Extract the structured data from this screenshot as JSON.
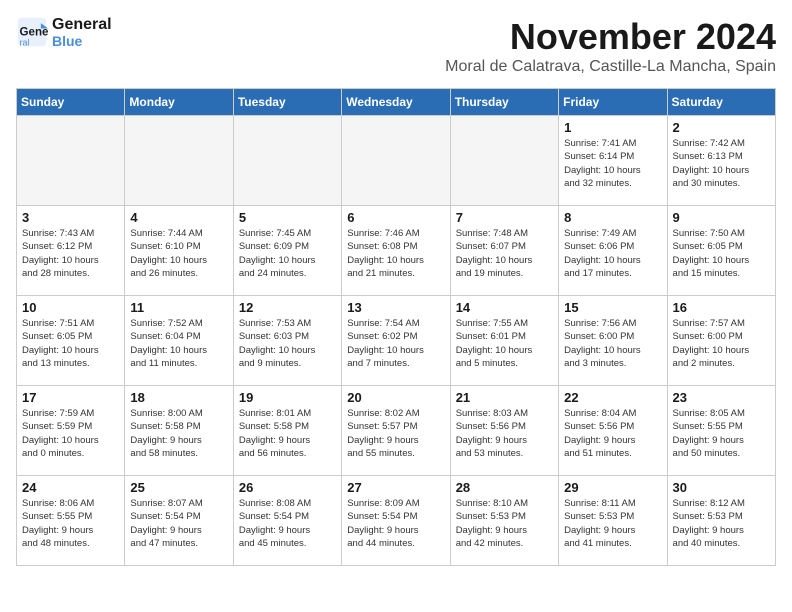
{
  "logo": {
    "line1": "General",
    "line2": "Blue"
  },
  "title": "November 2024",
  "subtitle": "Moral de Calatrava, Castille-La Mancha, Spain",
  "weekdays": [
    "Sunday",
    "Monday",
    "Tuesday",
    "Wednesday",
    "Thursday",
    "Friday",
    "Saturday"
  ],
  "weeks": [
    [
      {
        "day": "",
        "info": ""
      },
      {
        "day": "",
        "info": ""
      },
      {
        "day": "",
        "info": ""
      },
      {
        "day": "",
        "info": ""
      },
      {
        "day": "",
        "info": ""
      },
      {
        "day": "1",
        "info": "Sunrise: 7:41 AM\nSunset: 6:14 PM\nDaylight: 10 hours\nand 32 minutes."
      },
      {
        "day": "2",
        "info": "Sunrise: 7:42 AM\nSunset: 6:13 PM\nDaylight: 10 hours\nand 30 minutes."
      }
    ],
    [
      {
        "day": "3",
        "info": "Sunrise: 7:43 AM\nSunset: 6:12 PM\nDaylight: 10 hours\nand 28 minutes."
      },
      {
        "day": "4",
        "info": "Sunrise: 7:44 AM\nSunset: 6:10 PM\nDaylight: 10 hours\nand 26 minutes."
      },
      {
        "day": "5",
        "info": "Sunrise: 7:45 AM\nSunset: 6:09 PM\nDaylight: 10 hours\nand 24 minutes."
      },
      {
        "day": "6",
        "info": "Sunrise: 7:46 AM\nSunset: 6:08 PM\nDaylight: 10 hours\nand 21 minutes."
      },
      {
        "day": "7",
        "info": "Sunrise: 7:48 AM\nSunset: 6:07 PM\nDaylight: 10 hours\nand 19 minutes."
      },
      {
        "day": "8",
        "info": "Sunrise: 7:49 AM\nSunset: 6:06 PM\nDaylight: 10 hours\nand 17 minutes."
      },
      {
        "day": "9",
        "info": "Sunrise: 7:50 AM\nSunset: 6:05 PM\nDaylight: 10 hours\nand 15 minutes."
      }
    ],
    [
      {
        "day": "10",
        "info": "Sunrise: 7:51 AM\nSunset: 6:05 PM\nDaylight: 10 hours\nand 13 minutes."
      },
      {
        "day": "11",
        "info": "Sunrise: 7:52 AM\nSunset: 6:04 PM\nDaylight: 10 hours\nand 11 minutes."
      },
      {
        "day": "12",
        "info": "Sunrise: 7:53 AM\nSunset: 6:03 PM\nDaylight: 10 hours\nand 9 minutes."
      },
      {
        "day": "13",
        "info": "Sunrise: 7:54 AM\nSunset: 6:02 PM\nDaylight: 10 hours\nand 7 minutes."
      },
      {
        "day": "14",
        "info": "Sunrise: 7:55 AM\nSunset: 6:01 PM\nDaylight: 10 hours\nand 5 minutes."
      },
      {
        "day": "15",
        "info": "Sunrise: 7:56 AM\nSunset: 6:00 PM\nDaylight: 10 hours\nand 3 minutes."
      },
      {
        "day": "16",
        "info": "Sunrise: 7:57 AM\nSunset: 6:00 PM\nDaylight: 10 hours\nand 2 minutes."
      }
    ],
    [
      {
        "day": "17",
        "info": "Sunrise: 7:59 AM\nSunset: 5:59 PM\nDaylight: 10 hours\nand 0 minutes."
      },
      {
        "day": "18",
        "info": "Sunrise: 8:00 AM\nSunset: 5:58 PM\nDaylight: 9 hours\nand 58 minutes."
      },
      {
        "day": "19",
        "info": "Sunrise: 8:01 AM\nSunset: 5:58 PM\nDaylight: 9 hours\nand 56 minutes."
      },
      {
        "day": "20",
        "info": "Sunrise: 8:02 AM\nSunset: 5:57 PM\nDaylight: 9 hours\nand 55 minutes."
      },
      {
        "day": "21",
        "info": "Sunrise: 8:03 AM\nSunset: 5:56 PM\nDaylight: 9 hours\nand 53 minutes."
      },
      {
        "day": "22",
        "info": "Sunrise: 8:04 AM\nSunset: 5:56 PM\nDaylight: 9 hours\nand 51 minutes."
      },
      {
        "day": "23",
        "info": "Sunrise: 8:05 AM\nSunset: 5:55 PM\nDaylight: 9 hours\nand 50 minutes."
      }
    ],
    [
      {
        "day": "24",
        "info": "Sunrise: 8:06 AM\nSunset: 5:55 PM\nDaylight: 9 hours\nand 48 minutes."
      },
      {
        "day": "25",
        "info": "Sunrise: 8:07 AM\nSunset: 5:54 PM\nDaylight: 9 hours\nand 47 minutes."
      },
      {
        "day": "26",
        "info": "Sunrise: 8:08 AM\nSunset: 5:54 PM\nDaylight: 9 hours\nand 45 minutes."
      },
      {
        "day": "27",
        "info": "Sunrise: 8:09 AM\nSunset: 5:54 PM\nDaylight: 9 hours\nand 44 minutes."
      },
      {
        "day": "28",
        "info": "Sunrise: 8:10 AM\nSunset: 5:53 PM\nDaylight: 9 hours\nand 42 minutes."
      },
      {
        "day": "29",
        "info": "Sunrise: 8:11 AM\nSunset: 5:53 PM\nDaylight: 9 hours\nand 41 minutes."
      },
      {
        "day": "30",
        "info": "Sunrise: 8:12 AM\nSunset: 5:53 PM\nDaylight: 9 hours\nand 40 minutes."
      }
    ]
  ]
}
